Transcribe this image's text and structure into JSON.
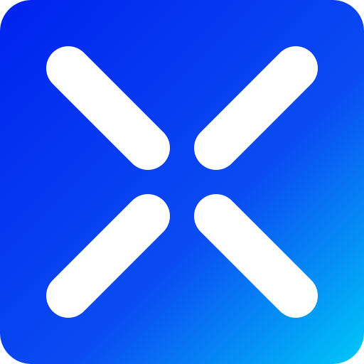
{
  "app_icon": {
    "name": "x-cross-app-icon",
    "colors": {
      "gradient_start": "#0022ee",
      "gradient_mid": "#0a4cf2",
      "gradient_end": "#00c8f8",
      "mark": "#ffffff"
    }
  }
}
